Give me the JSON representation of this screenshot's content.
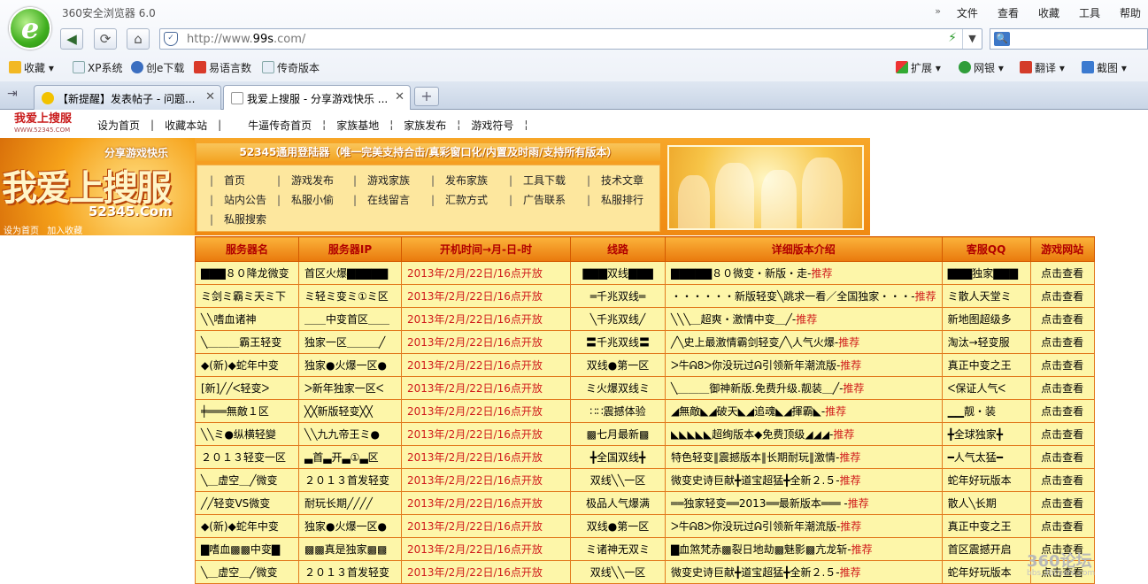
{
  "app": {
    "title": "360安全浏览器 6.0"
  },
  "menubar": {
    "chevron": "»",
    "items": [
      "文件",
      "查看",
      "收藏",
      "工具",
      "帮助"
    ]
  },
  "address": {
    "url_prefix": "http://www.",
    "url_host": "99s",
    "url_suffix": ".com/"
  },
  "favorites": [
    {
      "label": "收藏"
    },
    {
      "label": "XP系统"
    },
    {
      "label": "创e下载"
    },
    {
      "label": "易语言数"
    },
    {
      "label": "传奇版本"
    }
  ],
  "favbar_right": [
    {
      "label": "扩展"
    },
    {
      "label": "网银"
    },
    {
      "label": "翻译"
    },
    {
      "label": "截图"
    }
  ],
  "tabs": [
    {
      "label": "【新提醒】发表帖子 - 问题..."
    },
    {
      "label": "我爱上搜服 - 分享游戏快乐 ..."
    }
  ],
  "site": {
    "logo_text": "我爱上搜服",
    "logo_sub": "WWW.52345.COM",
    "top_nav": [
      "设为首页",
      "收藏本站",
      "牛逼传奇首页",
      "家族基地",
      "家族发布",
      "游戏符号"
    ],
    "banner": {
      "slogan": "分享游戏快乐",
      "brand": "我爱上搜服",
      "domain": "52345.Com",
      "set_home": "设为首页",
      "add_fav": "加入收藏",
      "headline": "52345通用登陆器（唯一完美支持合击/真彩窗口化/内置及时雨/支持所有版本）",
      "menu": [
        [
          "首页",
          "游戏发布",
          "游戏家族",
          "发布家族",
          "工具下载",
          "技术文章"
        ],
        [
          "站内公告",
          "私服小偷",
          "在线留言",
          "汇款方式",
          "广告联系",
          "私服排行"
        ],
        [
          "私服搜索"
        ]
      ]
    }
  },
  "table": {
    "headers": [
      "服务器名",
      "服务器IP",
      "开机时间→月-日-时",
      "线路",
      "详细版本介绍",
      "客服QQ",
      "游戏网站"
    ],
    "rows": [
      {
        "name": "▇▇▇８０降龙微变",
        "ip": "首区火爆▇▇▇▇▇",
        "time": "2013年/2月/22日/16点开放",
        "line": "▇▇▇双线▇▇▇",
        "desc": "▇▇▇▇▇８０微变・新版・走-",
        "tag": "推荐",
        "qq": "▇▇▇独家▇▇▇",
        "site": "点击查看"
      },
      {
        "name": "ミ剑ミ霸ミ天ミ下",
        "ip": "ミ轻ミ变ミ①ミ区",
        "time": "2013年/2月/22日/16点开放",
        "line": "═千兆双线═",
        "desc": "・・・・・・新版轻变╲跳求一看／全国独家・・・-",
        "tag": "推荐",
        "qq": "ミ散人天堂ミ",
        "site": "点击查看"
      },
      {
        "name": "╲╲嗜血诸神",
        "ip": "＿＿中变首区＿＿",
        "time": "2013年/2月/22日/16点开放",
        "line": "╲千兆双线╱",
        "desc": "╲╲╲＿超爽・激情中变＿╱-",
        "tag": "推荐",
        "qq": "新地图超级多",
        "site": "点击查看"
      },
      {
        "name": "╲＿＿＿霸王轻变",
        "ip": "独家一区＿＿＿╱",
        "time": "2013年/2月/22日/16点开放",
        "line": "〓千兆双线〓",
        "desc": "╱╲史上最激情霸剑轻变╱╲人气火爆-",
        "tag": "推荐",
        "qq": "淘汰→轻变服",
        "site": "点击查看"
      },
      {
        "name": "◆(新)◆蛇年中变",
        "ip": "独家●火爆一区●",
        "time": "2013年/2月/22日/16点开放",
        "line": "双线●第一区",
        "desc": "ᐳ牛ᕱ8ᐳ你没玩过ᕱ引领新年潮流版-",
        "tag": "推荐",
        "qq": "真正中变之王",
        "site": "点击查看"
      },
      {
        "name": "[新]╱╱ᐸ轻变ᐳ",
        "ip": "ᐳ新年独家一区ᐸ",
        "time": "2013年/2月/22日/16点开放",
        "line": "ミ火爆双线ミ",
        "desc": "╲＿＿＿御神新版.免费升级.靓装＿╱-",
        "tag": "推荐",
        "qq": "ᐸ保证人气ᐸ",
        "site": "点击查看"
      },
      {
        "name": "╪═══無敵１区",
        "ip": "╳╳新版轻变╳╳",
        "time": "2013年/2月/22日/16点开放",
        "line": "∷∷震撼体验",
        "desc": "◢無敵◣◢破天◣◢追魂◣◢揮霸◣-",
        "tag": "推荐",
        "qq": "▁▁靓・装",
        "site": "点击查看"
      },
      {
        "name": "╲╲ミ●纵横轻變",
        "ip": "╲╲九九帝王ミ●",
        "time": "2013年/2月/22日/16点开放",
        "line": "▩七月最新▩",
        "desc": "◣◣◣◣◣超绚版本◆免费顶级◢◢◢-",
        "tag": "推荐",
        "qq": "╋全球独家╋",
        "site": "点击查看"
      },
      {
        "name": "２０１３轻变一区",
        "ip": "▃首▃开▃①▃区",
        "time": "2013年/2月/22日/16点开放",
        "line": "╋全国双线╋",
        "desc": "特色轻变‖震撼版本‖长期耐玩‖激情-",
        "tag": "推荐",
        "qq": "━人气太猛━",
        "site": "点击查看"
      },
      {
        "name": "╲＿虚空＿╱微变",
        "ip": "２０１３首发轻变",
        "time": "2013年/2月/22日/16点开放",
        "line": "双线╲╲一区",
        "desc": "微变史诗巨献╋道宝超猛╋全新２.５-",
        "tag": "推荐",
        "qq": "蛇年好玩版本",
        "site": "点击查看"
      },
      {
        "name": "╱╱轻变VS微变",
        "ip": "耐玩长期╱╱╱╱",
        "time": "2013年/2月/22日/16点开放",
        "line": "极品人气爆满",
        "desc": "══独家轻变══2013══最新版本═══ -",
        "tag": "推荐",
        "qq": "散人╲长期",
        "site": "点击查看"
      },
      {
        "name": "◆(新)◆蛇年中变",
        "ip": "独家●火爆一区●",
        "time": "2013年/2月/22日/16点开放",
        "line": "双线●第一区",
        "desc": "ᐳ牛ᕱ8ᐳ你没玩过ᕱ引领新年潮流版-",
        "tag": "推荐",
        "qq": "真正中变之王",
        "site": "点击查看"
      },
      {
        "name": "▇嗜血▩▩中变▇",
        "ip": "▩▩真是独家▩▩",
        "time": "2013年/2月/22日/16点开放",
        "line": "ミ诸神无双ミ",
        "desc": "▇血煞梵赤▩裂日地劫▩魅影▩亢龙斩-",
        "tag": "推荐",
        "qq": "首区震撼开启",
        "site": "点击查看"
      },
      {
        "name": "╲＿虚空＿╱微变",
        "ip": "２０１３首发轻变",
        "time": "2013年/2月/22日/16点开放",
        "line": "双线╲╲一区",
        "desc": "微变史诗巨献╋道宝超猛╋全新２.５-",
        "tag": "推荐",
        "qq": "蛇年好玩版本",
        "site": "点击查看"
      }
    ]
  },
  "watermark": {
    "brand": "360论坛",
    "url": "bbs.360safe.com"
  }
}
